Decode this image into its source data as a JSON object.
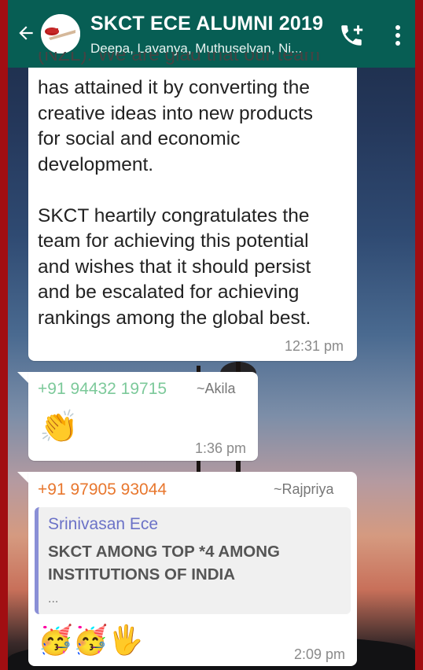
{
  "header": {
    "title": "SKCT ECE ALUMNI 2019",
    "subtitle": "Deepa, Lavanya, Muthuselvan, Ni..."
  },
  "messages": [
    {
      "lines_partial": "(NZL). We are glad that our team",
      "lines": [
        "has attained it by converting the",
        "creative ideas into new products",
        "for social and economic",
        "development.",
        "",
        "SKCT heartily congratulates the",
        "team for achieving this potential",
        "and wishes that it should persist",
        "and be escalated for achieving",
        "rankings among the global best."
      ],
      "time": "12:31 pm"
    },
    {
      "sender": "+91 94432 19715",
      "alias": "~Akila",
      "sender_color": "#7cc99a",
      "emoji": "👏",
      "time": "1:36 pm"
    },
    {
      "sender": "+91 97905 93044",
      "alias": "~Rajpriya",
      "sender_color": "#e8772e",
      "quote_author": "Srinivasan Ece",
      "quote_lines": [
        "SKCT AMONG TOP *4 AMONG",
        "INSTITUTIONS OF INDIA"
      ],
      "quote_more": "...",
      "emojis": "🥳🥳🖐",
      "time": "2:09 pm"
    }
  ],
  "colors": {
    "header": "#075e54",
    "frame": "#a10e12",
    "quote_bar": "#8a8fd6"
  }
}
